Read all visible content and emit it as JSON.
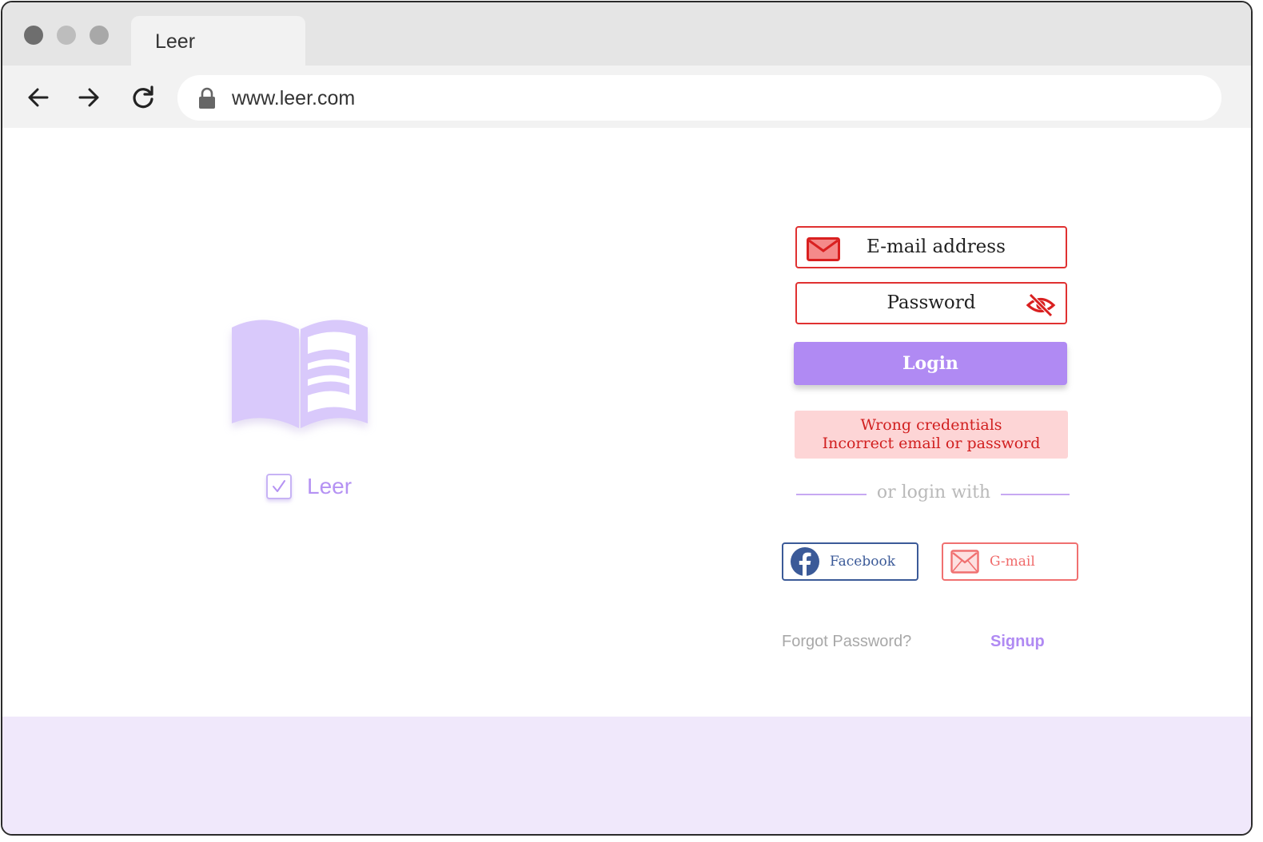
{
  "browser": {
    "tab_title": "Leer",
    "url": "www.leer.com",
    "icons": {
      "back": "arrow-left-icon",
      "forward": "arrow-right-icon",
      "reload": "reload-icon",
      "lock": "lock-icon"
    }
  },
  "brand": {
    "name": "Leer",
    "logo_icon": "open-book-icon",
    "check_icon": "checkbox-check-icon",
    "color": "#b592f3"
  },
  "login_form": {
    "email_placeholder": "E-mail address",
    "password_placeholder": "Password",
    "login_label": "Login",
    "error_title": "Wrong credentials",
    "error_message": "Incorrect email or password",
    "divider_text": "or login with",
    "facebook_label": "Facebook",
    "gmail_label": "G-mail",
    "forgot_label": "Forgot Password?",
    "signup_label": "Signup"
  },
  "colors": {
    "accent": "#b08af3",
    "error": "#e03131",
    "error_bg": "#fdd5d6",
    "facebook": "#3b5a98",
    "gmail": "#f07070",
    "footer_band": "#f0e8fb"
  }
}
